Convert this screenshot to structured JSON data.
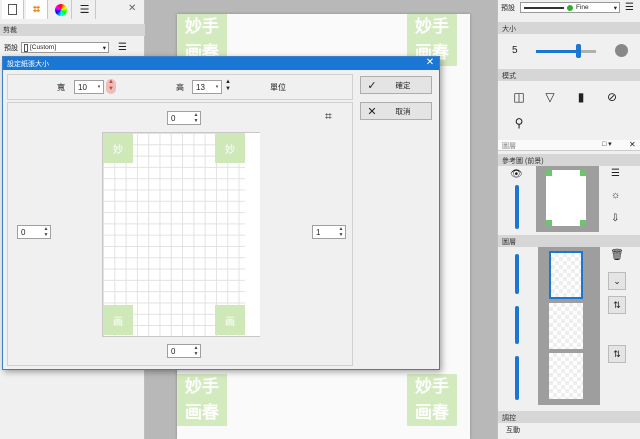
{
  "left_panel": {
    "section_crop": "剪裁",
    "preset_label": "預設",
    "preset_value": "[Custom]"
  },
  "right_panel": {
    "brush_preset_label": "預設",
    "brush_quality": "Fine",
    "size_header": "大小",
    "size_value": "5",
    "size_fraction": 0.7,
    "mode_header": "模式",
    "layers_tab": "圖層",
    "reference_header": "參考圖 (前景)",
    "layers_header": "圖層",
    "adjust_header": "調控",
    "interactive_label": "互動"
  },
  "dialog": {
    "title": "設定紙張大小",
    "width_label": "寬",
    "width_value": "10",
    "height_label": "高",
    "height_value": "13",
    "unit_label": "單位",
    "ok_label": "確定",
    "cancel_label": "取消",
    "margin_top": "0",
    "margin_left": "0",
    "margin_right": "1",
    "margin_bottom": "0"
  },
  "stamp_text": [
    "妙",
    "手",
    "画",
    "春"
  ],
  "colors": {
    "accent": "#1a78d4",
    "stamp": "#cfe8b8"
  }
}
